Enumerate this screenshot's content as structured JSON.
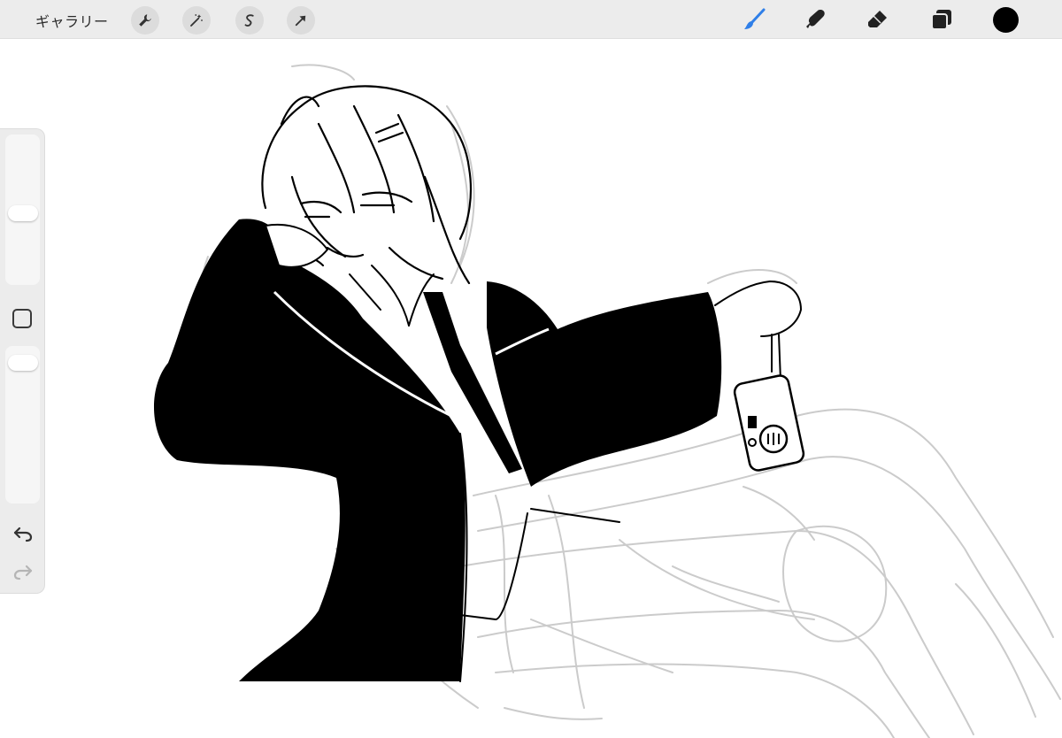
{
  "toolbar": {
    "gallery_label": "ギャラリー",
    "left_tools": [
      {
        "name": "actions",
        "icon": "wrench-icon"
      },
      {
        "name": "adjustments",
        "icon": "magic-wand-icon"
      },
      {
        "name": "selection",
        "icon": "selection-s-icon"
      },
      {
        "name": "transform",
        "icon": "arrow-cursor-icon"
      }
    ],
    "right_tools": [
      {
        "name": "brush",
        "icon": "brush-icon",
        "active": true
      },
      {
        "name": "smudge",
        "icon": "smudge-finger-icon"
      },
      {
        "name": "eraser",
        "icon": "eraser-icon"
      },
      {
        "name": "layers",
        "icon": "layers-icon"
      }
    ],
    "current_color": "#000000",
    "active_color": "#2f7fe8"
  },
  "sidebar": {
    "brush_size_level": 0.55,
    "opacity_level": 0.93,
    "modify_button_icon": "square-icon",
    "undo_icon": "undo-arrow-icon",
    "redo_icon": "redo-arrow-icon"
  },
  "canvas": {
    "background": "#ffffff",
    "ink_color": "#000000",
    "sketch_color": "#c8c8c8"
  }
}
